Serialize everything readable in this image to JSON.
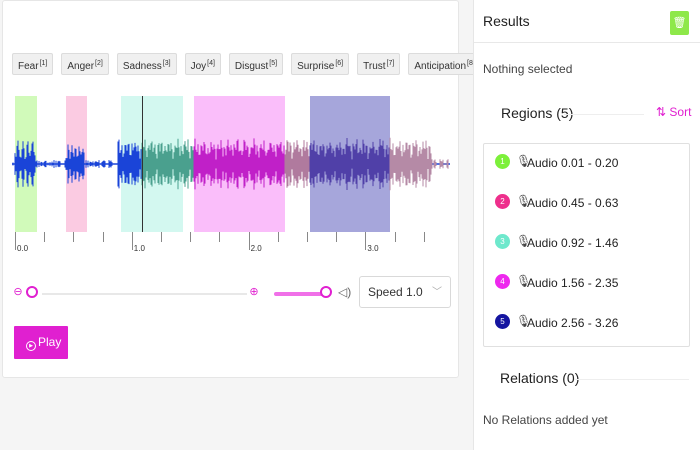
{
  "labels": [
    {
      "name": "Fear",
      "hotkey": "[1]"
    },
    {
      "name": "Anger",
      "hotkey": "[2]"
    },
    {
      "name": "Sadness",
      "hotkey": "[3]"
    },
    {
      "name": "Joy",
      "hotkey": "[4]"
    },
    {
      "name": "Disgust",
      "hotkey": "[5]"
    },
    {
      "name": "Surprise",
      "hotkey": "[6]"
    },
    {
      "name": "Trust",
      "hotkey": "[7]"
    },
    {
      "name": "Anticipation",
      "hotkey": "[8]"
    }
  ],
  "timeline": {
    "labels": [
      "0.0",
      "1.0",
      "2.0",
      "3.0"
    ]
  },
  "controls": {
    "speed_label": "Speed 1.0",
    "play_label": "Play",
    "zoom_out_icon": "zoom-out-icon",
    "zoom_in_icon": "zoom-in-icon",
    "volume_icon": "volume-icon"
  },
  "results": {
    "title": "Results",
    "nothing_selected": "Nothing selected",
    "regions_title": "Regions (5)",
    "sort_label": "Sort",
    "regions": [
      {
        "num": "1",
        "label": "Audio 0.01 - 0.20",
        "color": "#7cf03a"
      },
      {
        "num": "2",
        "label": "Audio 0.45 - 0.63",
        "color": "#ee2f8c"
      },
      {
        "num": "3",
        "label": "Audio 0.92 - 1.46",
        "color": "#6ee8cc"
      },
      {
        "num": "4",
        "label": "Audio 1.56 - 2.35",
        "color": "#ee28ee"
      },
      {
        "num": "5",
        "label": "Audio 2.56 - 3.26",
        "color": "#1515a0"
      }
    ],
    "relations_title": "Relations (0)",
    "no_relations": "No Relations added yet"
  },
  "colors": {
    "accent": "#e020d0",
    "trash_bg": "#8ee84a",
    "wave": "#1a44d8"
  }
}
